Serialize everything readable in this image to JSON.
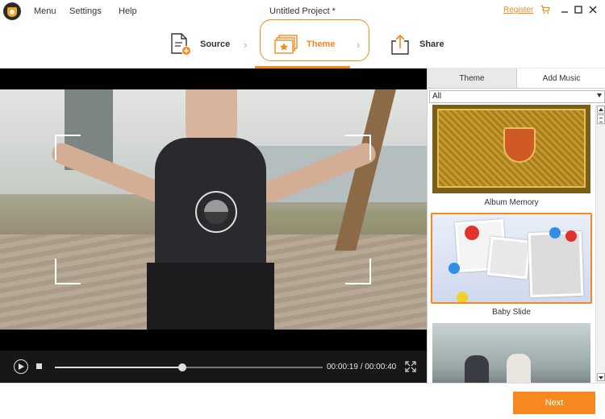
{
  "app": {
    "title": "Untitled Project *"
  },
  "menu": {
    "items": [
      "Menu",
      "Settings",
      "Help"
    ]
  },
  "header": {
    "register": "Register"
  },
  "steps": [
    {
      "label": "Source",
      "icon": "document-add-icon"
    },
    {
      "label": "Theme",
      "icon": "theme-icon",
      "active": true
    },
    {
      "label": "Share",
      "icon": "share-upload-icon"
    }
  ],
  "player": {
    "current_time": "00:00:19",
    "total_time": "00:00:40",
    "time_display": "00:00:19 / 00:00:40",
    "progress": 0.475
  },
  "panel": {
    "tabs": [
      "Theme",
      "Add Music"
    ],
    "active_tab": "Theme",
    "filter_value": "All",
    "themes": [
      {
        "name": "Album Memory",
        "selected": false
      },
      {
        "name": "Baby Slide",
        "selected": true
      },
      {
        "name": "",
        "selected": false
      }
    ]
  },
  "footer": {
    "next_label": "Next"
  },
  "colors": {
    "accent": "#f5891f",
    "control_bar": "#171717"
  }
}
